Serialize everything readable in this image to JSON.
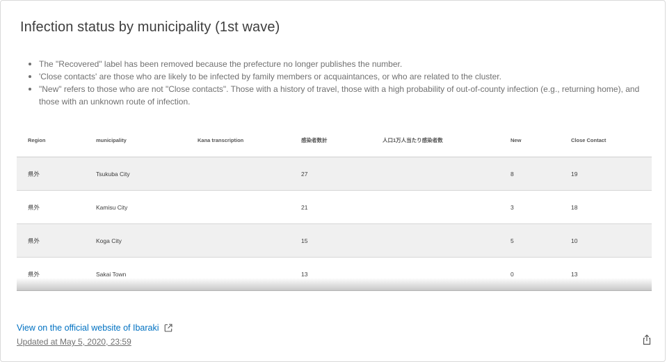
{
  "card": {
    "title": "Infection status by municipality (1st wave)",
    "notes": [
      "The \"Recovered\" label has been removed because the prefecture no longer publishes the number.",
      "'Close contacts' are those who are likely to be infected by family members or acquaintances, or who are related to the cluster.",
      "\"New\" refers to those who are not \"Close contacts\". Those with a history of travel, those with a high probability of out-of-county infection (e.g., returning home), and those with an unknown route of infection."
    ]
  },
  "table": {
    "headers": [
      "Region",
      "municipality",
      "Kana transcription",
      "感染者数計",
      "人口1万人当たり感染者数",
      "New",
      "Close Contact"
    ],
    "rows": [
      [
        "県外",
        "Tsukuba City",
        "",
        "27",
        "",
        "8",
        "19"
      ],
      [
        "県外",
        "Kamisu City",
        "",
        "21",
        "",
        "3",
        "18"
      ],
      [
        "県外",
        "Koga City",
        "",
        "15",
        "",
        "5",
        "10"
      ],
      [
        "県外",
        "Sakai Town",
        "",
        "13",
        "",
        "0",
        "13"
      ]
    ]
  },
  "footer": {
    "link_label": "View on the official website of Ibaraki",
    "updated": "Updated at May 5, 2020, 23:59",
    "link_icon": "external-link-icon",
    "share_icon": "share-icon",
    "link_color": "#0071c2"
  }
}
